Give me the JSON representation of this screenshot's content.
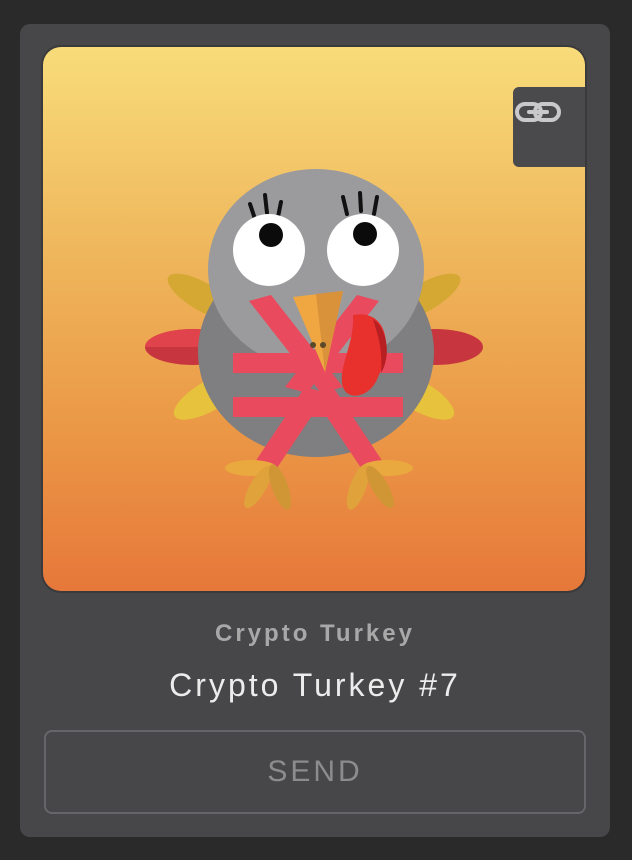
{
  "card": {
    "collection_name": "Crypto Turkey",
    "token_name": "Crypto Turkey #7",
    "send_label": "SEND",
    "link_icon": "link-icon",
    "artwork_icon": "turkey-illustration"
  },
  "colors": {
    "card_background": "#474749",
    "page_background": "#2a2a2b",
    "art_gradient_top": "#f8dc7a",
    "art_gradient_bottom": "#e6783a",
    "ribbon": "#e94a5e",
    "beak": "#f0a742",
    "tongue": "#e8302d"
  }
}
